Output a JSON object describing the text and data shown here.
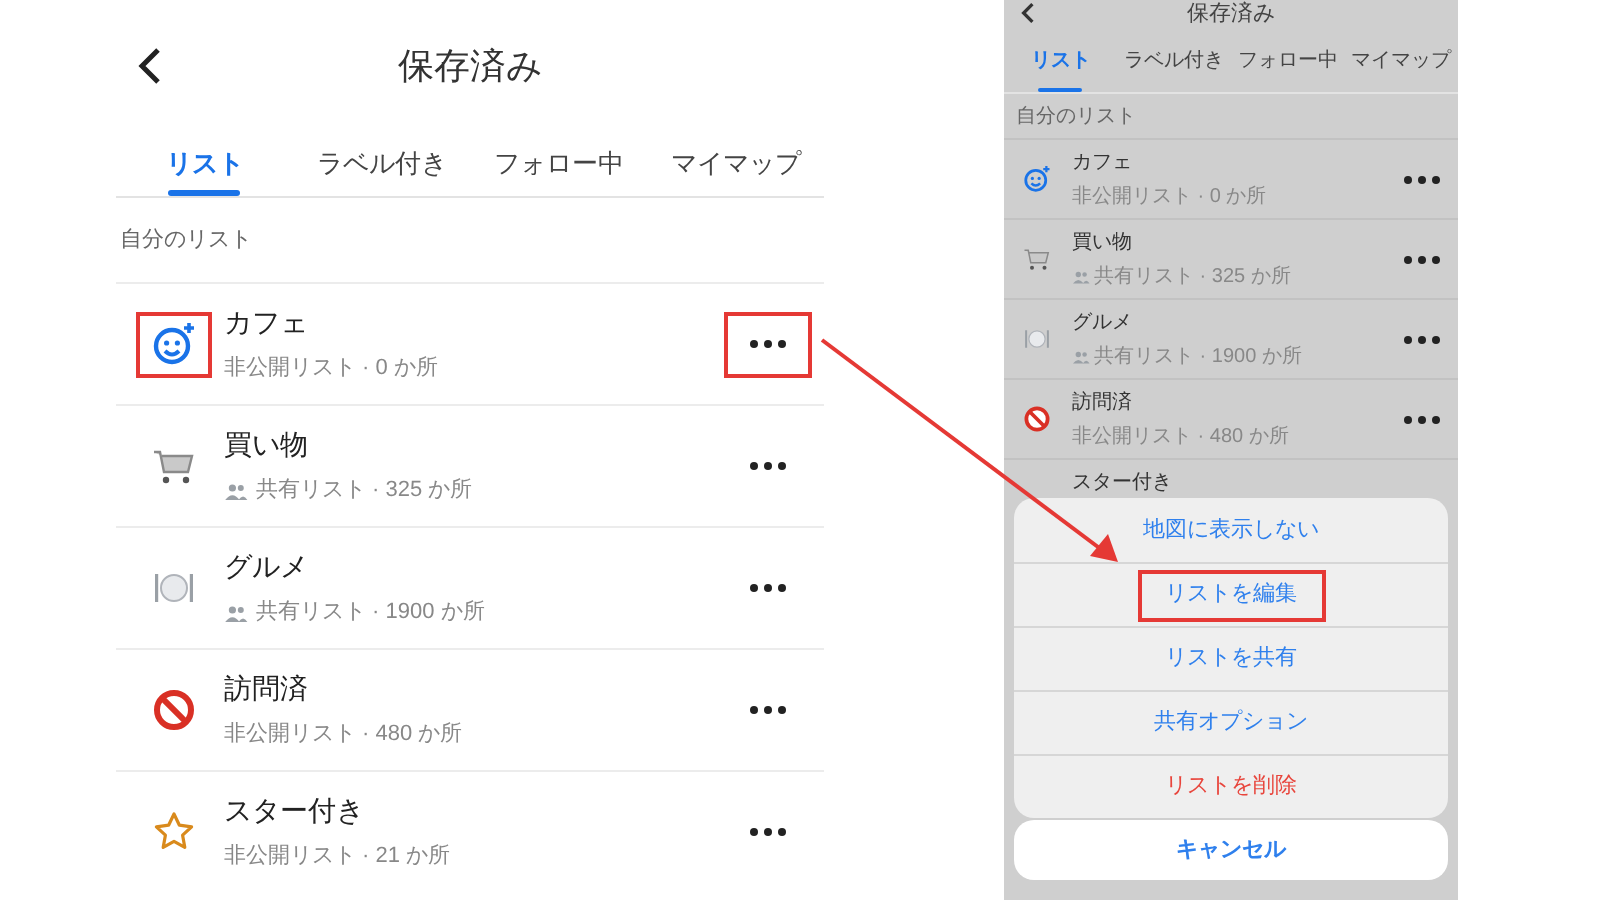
{
  "left_screen": {
    "title": "保存済み",
    "tabs": [
      {
        "label": "リスト",
        "selected": true
      },
      {
        "label": "ラベル付き",
        "selected": false
      },
      {
        "label": "フォロー中",
        "selected": false
      },
      {
        "label": "マイマップ",
        "selected": false
      }
    ],
    "section_label": "自分のリスト",
    "lists": [
      {
        "kind": "smiley",
        "name": "カフェ",
        "detail": "非公開リスト · 0 か所",
        "shared": false,
        "highlighted": true
      },
      {
        "kind": "cart",
        "name": "買い物",
        "detail": "共有リスト · 325 か所",
        "shared": true,
        "highlighted": false
      },
      {
        "kind": "dining",
        "name": "グルメ",
        "detail": "共有リスト · 1900 か所",
        "shared": true,
        "highlighted": false
      },
      {
        "kind": "prohibited",
        "name": "訪問済",
        "detail": "非公開リスト · 480 か所",
        "shared": false,
        "highlighted": false
      },
      {
        "kind": "star",
        "name": "スター付き",
        "detail": "非公開リスト · 21 か所",
        "shared": false,
        "highlighted": false
      }
    ]
  },
  "right_screen": {
    "title": "保存済み",
    "tabs": [
      {
        "label": "リスト",
        "selected": true
      },
      {
        "label": "ラベル付き",
        "selected": false
      },
      {
        "label": "フォロー中",
        "selected": false
      },
      {
        "label": "マイマップ",
        "selected": false
      }
    ],
    "section_label": "自分のリスト",
    "lists": [
      {
        "kind": "smiley",
        "name": "カフェ",
        "detail": "非公開リスト · 0 か所",
        "shared": false
      },
      {
        "kind": "cart",
        "name": "買い物",
        "detail": "共有リスト · 325 か所",
        "shared": true
      },
      {
        "kind": "dining",
        "name": "グルメ",
        "detail": "共有リスト · 1900 か所",
        "shared": true
      },
      {
        "kind": "prohibited",
        "name": "訪問済",
        "detail": "非公開リスト · 480 か所",
        "shared": false
      },
      {
        "name": "スター付き"
      }
    ],
    "action_sheet": {
      "actions": [
        {
          "label": "地図に表示しない",
          "kind": "normal",
          "highlighted": false
        },
        {
          "label": "リストを編集",
          "kind": "normal",
          "highlighted": true
        },
        {
          "label": "リストを共有",
          "kind": "normal",
          "highlighted": false
        },
        {
          "label": "共有オプション",
          "kind": "normal",
          "highlighted": false
        },
        {
          "label": "リストを削除",
          "kind": "destructive",
          "highlighted": false
        }
      ],
      "cancel": "キャンセル"
    }
  }
}
